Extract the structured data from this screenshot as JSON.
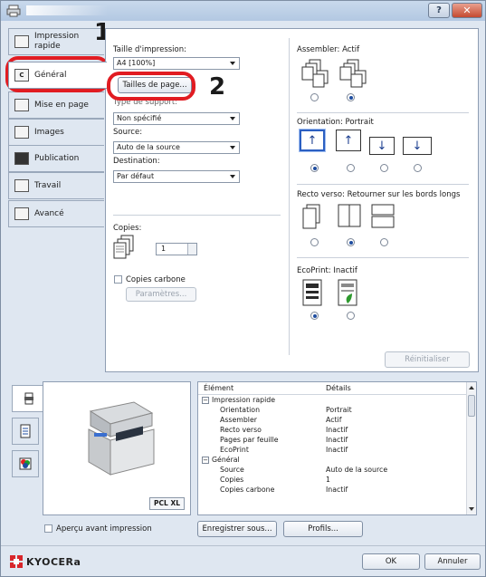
{
  "tabs": [
    {
      "label": "Impression\nrapide",
      "icon": "quick-print-icon"
    },
    {
      "label": "Général",
      "icon": "general-icon"
    },
    {
      "label": "Mise en page",
      "icon": "layout-icon"
    },
    {
      "label": "Images",
      "icon": "images-icon"
    },
    {
      "label": "Publication",
      "icon": "publication-icon"
    },
    {
      "label": "Travail",
      "icon": "job-icon"
    },
    {
      "label": "Avancé",
      "icon": "advanced-icon"
    }
  ],
  "general": {
    "print_size_label": "Taille d'impression:",
    "print_size_value": "A4 [100%]",
    "page_sizes_button": "Tailles de page...",
    "media_type_label": "Type de support:",
    "media_type_value": "Non spécifié",
    "source_label": "Source:",
    "source_value": "Auto de la source",
    "destination_label": "Destination:",
    "destination_value": "Par défaut",
    "copies_label": "Copies:",
    "copies_value": "1",
    "carbon_copies_label": "Copies carbone",
    "parameters_button": "Paramètres...",
    "collate_label": "Assembler: Actif",
    "orientation_label": "Orientation: Portrait",
    "duplex_label": "Recto verso: Retourner sur les bords longs",
    "ecoprint_label": "EcoPrint: Inactif",
    "reset_button": "Réinitialiser"
  },
  "callouts": {
    "one": "1",
    "two": "2"
  },
  "preview": {
    "pdl": "PCL XL",
    "preview_checkbox": "Aperçu avant impression"
  },
  "summary": {
    "col_item": "Élément",
    "col_details": "Détails",
    "rows": [
      {
        "item": "Impression rapide",
        "details": "",
        "group": true
      },
      {
        "item": "Orientation",
        "details": "Portrait",
        "group": false
      },
      {
        "item": "Assembler",
        "details": "Actif",
        "group": false
      },
      {
        "item": "Recto verso",
        "details": "Inactif",
        "group": false
      },
      {
        "item": "Pages par feuille",
        "details": "Inactif",
        "group": false
      },
      {
        "item": "EcoPrint",
        "details": "Inactif",
        "group": false
      },
      {
        "item": "Général",
        "details": "",
        "group": true
      },
      {
        "item": "Source",
        "details": "Auto de la source",
        "group": false
      },
      {
        "item": "Copies",
        "details": "1",
        "group": false
      },
      {
        "item": "Copies carbone",
        "details": "Inactif",
        "group": false
      }
    ]
  },
  "buttons": {
    "save_as": "Enregistrer sous...",
    "profiles": "Profils...",
    "ok": "OK",
    "cancel": "Annuler"
  },
  "brand": {
    "name": "KYOCERa"
  },
  "colors": {
    "callout": "#e11c22",
    "accent": "#1e4da0"
  }
}
